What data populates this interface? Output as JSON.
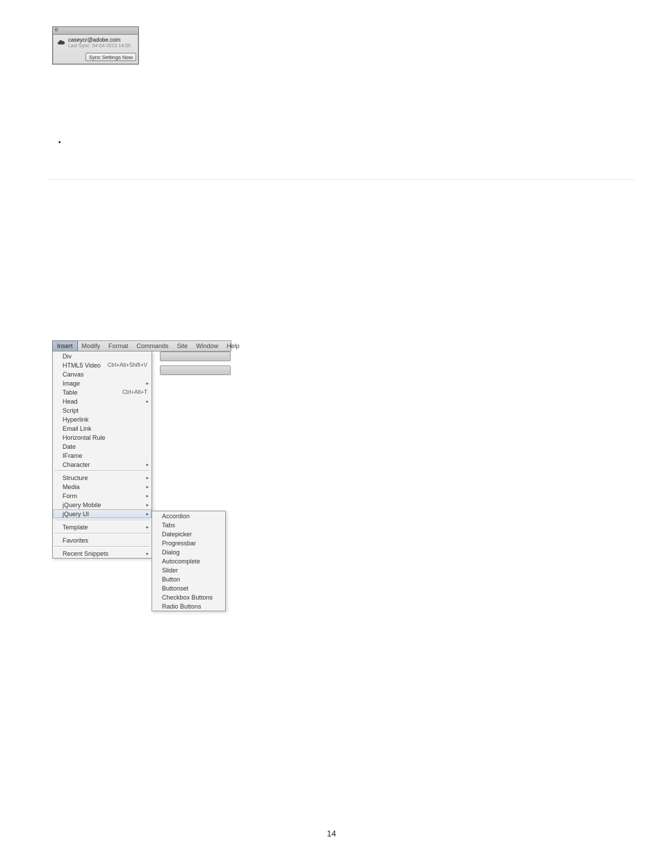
{
  "sync_panel": {
    "email": "caseycr@adobe.com",
    "last_sync": "Last Sync: 04-04-2013 14:05",
    "button": "Sync Settings Now"
  },
  "menubar": {
    "items": [
      "Insert",
      "Modify",
      "Format",
      "Commands",
      "Site",
      "Window",
      "Help"
    ],
    "active_index": 0
  },
  "insert_menu": [
    {
      "label": "Div"
    },
    {
      "label": "HTML5 Video",
      "accel": "Ctrl+Alt+Shift+V"
    },
    {
      "label": "Canvas"
    },
    {
      "label": "Image",
      "submenu": true
    },
    {
      "label": "Table",
      "accel": "Ctrl+Alt+T"
    },
    {
      "label": "Head",
      "submenu": true
    },
    {
      "label": "Script"
    },
    {
      "label": "Hyperlink"
    },
    {
      "label": "Email Link"
    },
    {
      "label": "Horizontal Rule"
    },
    {
      "label": "Date"
    },
    {
      "label": "IFrame"
    },
    {
      "label": "Character",
      "submenu": true
    },
    {
      "sep": true
    },
    {
      "label": "Structure",
      "submenu": true
    },
    {
      "label": "Media",
      "submenu": true
    },
    {
      "label": "Form",
      "submenu": true
    },
    {
      "label": "jQuery Mobile",
      "submenu": true
    },
    {
      "label": "jQuery UI",
      "submenu": true,
      "highlight": true
    },
    {
      "sep": true
    },
    {
      "label": "Template",
      "submenu": true
    },
    {
      "sep": true
    },
    {
      "label": "Favorites"
    },
    {
      "sep": true
    },
    {
      "label": "Recent Snippets",
      "submenu": true
    }
  ],
  "jquery_ui_submenu": [
    "Accordion",
    "Tabs",
    "Datepicker",
    "Progressbar",
    "Dialog",
    "Autocomplete",
    "Slider",
    "Button",
    "Buttonset",
    "Checkbox Buttons",
    "Radio Buttons"
  ],
  "page_number": "14"
}
